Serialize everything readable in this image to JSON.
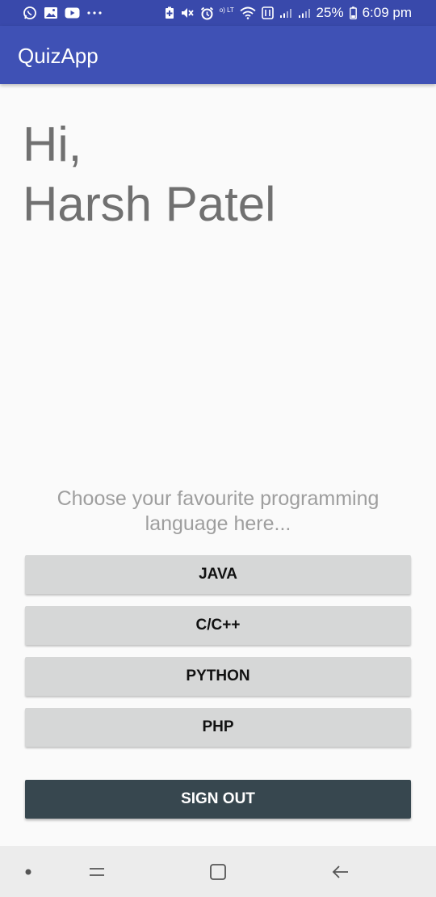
{
  "status_bar": {
    "battery": "25%",
    "time": "6:09 pm",
    "left_icons": [
      "whatsapp-icon",
      "gallery-icon",
      "youtube-icon",
      "more-dots-icon"
    ],
    "right_icons": [
      "battery-saver-icon",
      "mute-icon",
      "alarm-icon",
      "volte-icon",
      "wifi-icon",
      "data-icon",
      "signal-icon",
      "signal-icon",
      "battery-icon"
    ],
    "volte_label": "Vo) LTE"
  },
  "app_bar": {
    "title": "QuizApp",
    "color": "#3f51b5"
  },
  "greeting": {
    "line1": "Hi,",
    "line2": "Harsh Patel"
  },
  "prompt": "Choose your favourite programming language here...",
  "languages": [
    {
      "label": "JAVA"
    },
    {
      "label": "C/C++"
    },
    {
      "label": "PYTHON"
    },
    {
      "label": "PHP"
    }
  ],
  "sign_out": {
    "label": "SIGN OUT",
    "color": "#37474f"
  },
  "nav_bar": {
    "icons": [
      "dot-icon",
      "recents-icon",
      "home-icon",
      "back-icon"
    ]
  }
}
